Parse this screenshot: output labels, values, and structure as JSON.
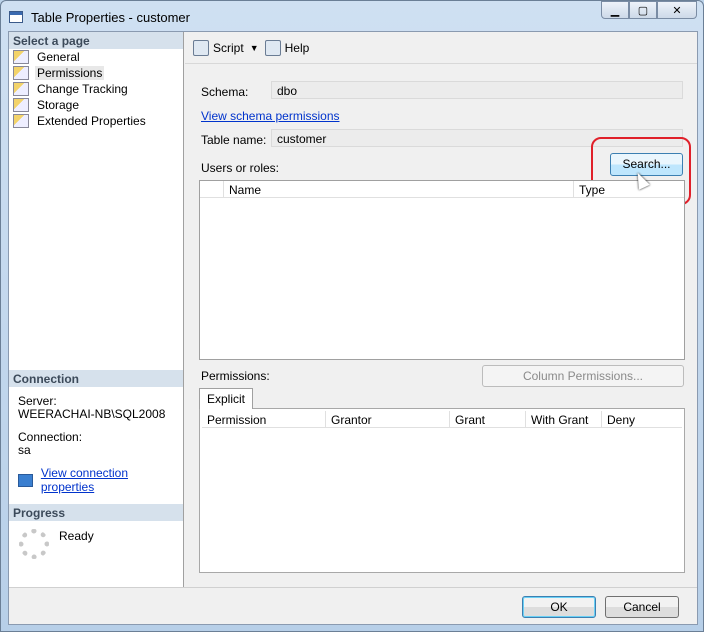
{
  "window": {
    "title": "Table Properties - customer"
  },
  "left": {
    "select_page": "Select a page",
    "pages": [
      {
        "label": "General"
      },
      {
        "label": "Permissions"
      },
      {
        "label": "Change Tracking"
      },
      {
        "label": "Storage"
      },
      {
        "label": "Extended Properties"
      }
    ],
    "connection": {
      "header": "Connection",
      "server_label": "Server:",
      "server": "WEERACHAI-NB\\SQL2008",
      "connection_label": "Connection:",
      "connection": "sa",
      "view_link": "View connection properties"
    },
    "progress": {
      "header": "Progress",
      "status": "Ready"
    }
  },
  "toolbar": {
    "script": "Script",
    "help": "Help"
  },
  "main": {
    "schema_label": "Schema:",
    "schema": "dbo",
    "view_schema_link": "View schema permissions",
    "table_name_label": "Table name:",
    "table_name": "customer",
    "users_label": "Users or roles:",
    "search": "Search...",
    "users_columns": [
      "Name",
      "Type"
    ],
    "permissions_label": "Permissions:",
    "column_permissions": "Column Permissions...",
    "tab": "Explicit",
    "perm_columns": [
      "Permission",
      "Grantor",
      "Grant",
      "With Grant",
      "Deny"
    ]
  },
  "footer": {
    "ok": "OK",
    "cancel": "Cancel"
  }
}
